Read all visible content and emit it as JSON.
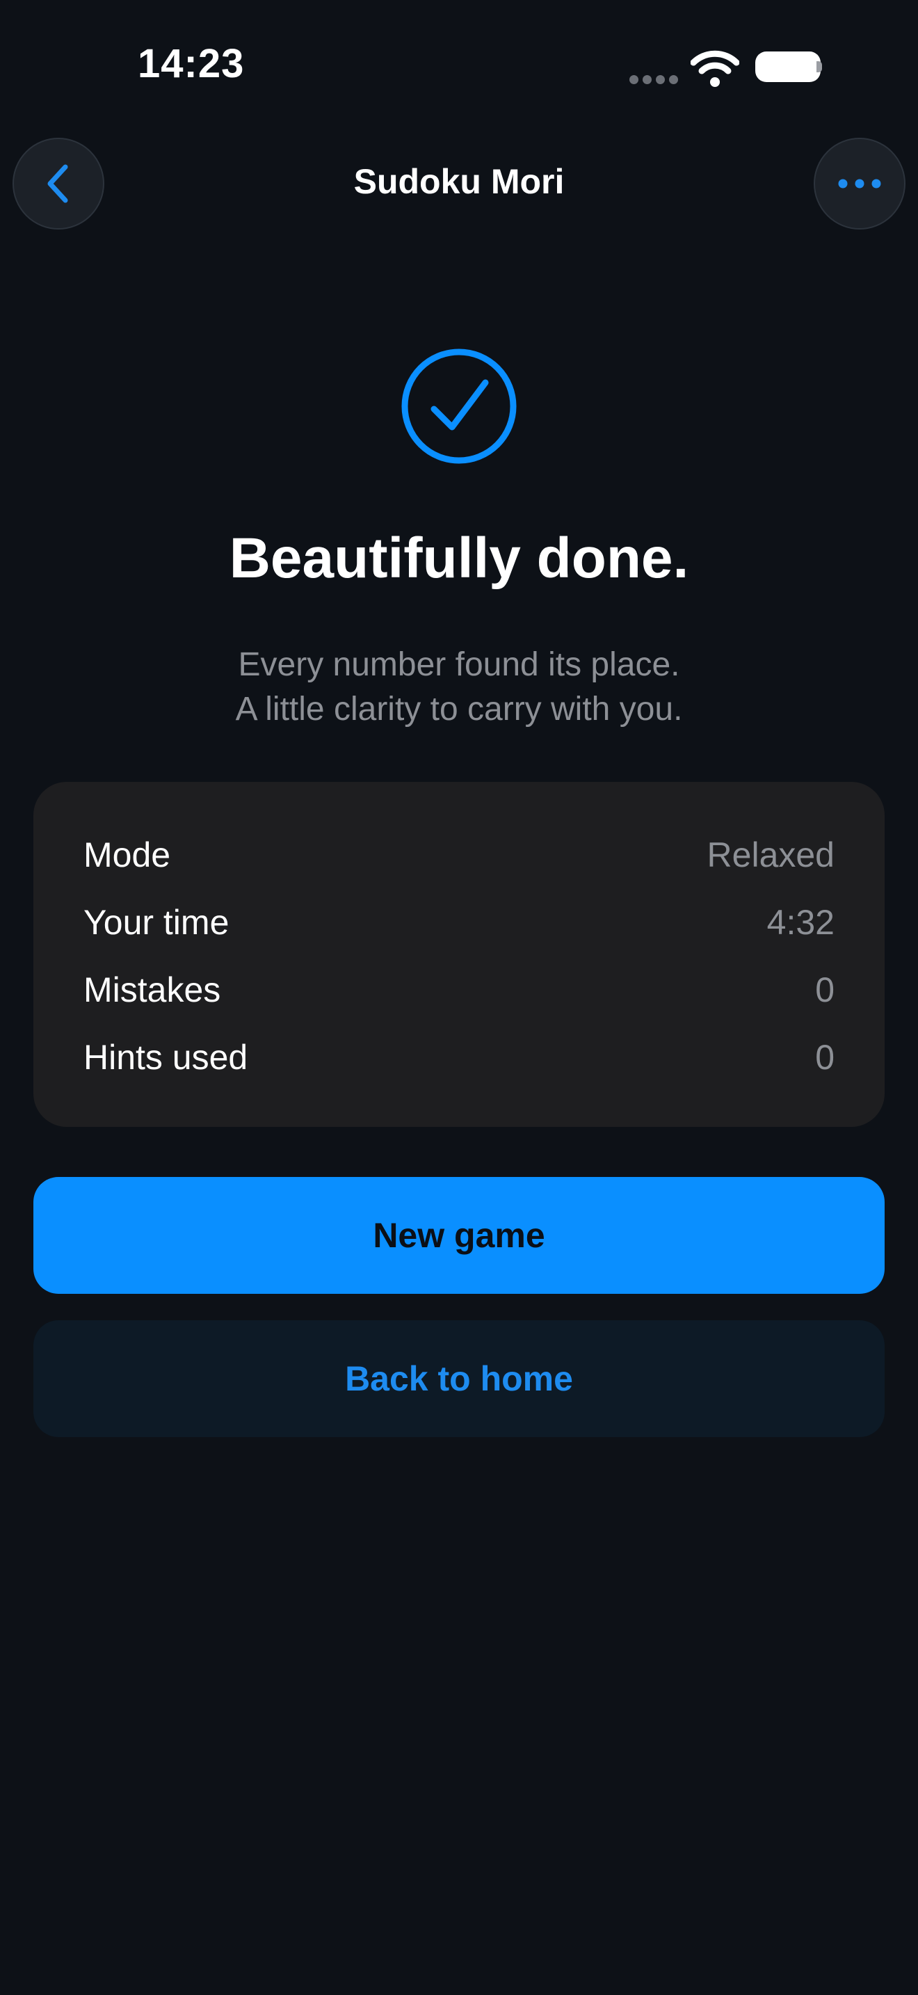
{
  "status_bar": {
    "time": "14:23"
  },
  "nav": {
    "title": "Sudoku Mori",
    "back_icon": "chevron-left-icon",
    "more_icon": "ellipsis-icon"
  },
  "hero": {
    "icon": "checkmark-circle-icon",
    "headline": "Beautifully done.",
    "subtitle_line1": "Every number found its place.",
    "subtitle_line2": "A little clarity to carry with you."
  },
  "stats": [
    {
      "label": "Mode",
      "value": "Relaxed"
    },
    {
      "label": "Your time",
      "value": "4:32"
    },
    {
      "label": "Mistakes",
      "value": "0"
    },
    {
      "label": "Hints used",
      "value": "0"
    }
  ],
  "actions": {
    "new_game": "New game",
    "back_home": "Back to home"
  },
  "colors": {
    "background": "#0d1117",
    "accent": "#0a8fff",
    "card": "#1e1e20",
    "muted_text": "#8d9096"
  }
}
